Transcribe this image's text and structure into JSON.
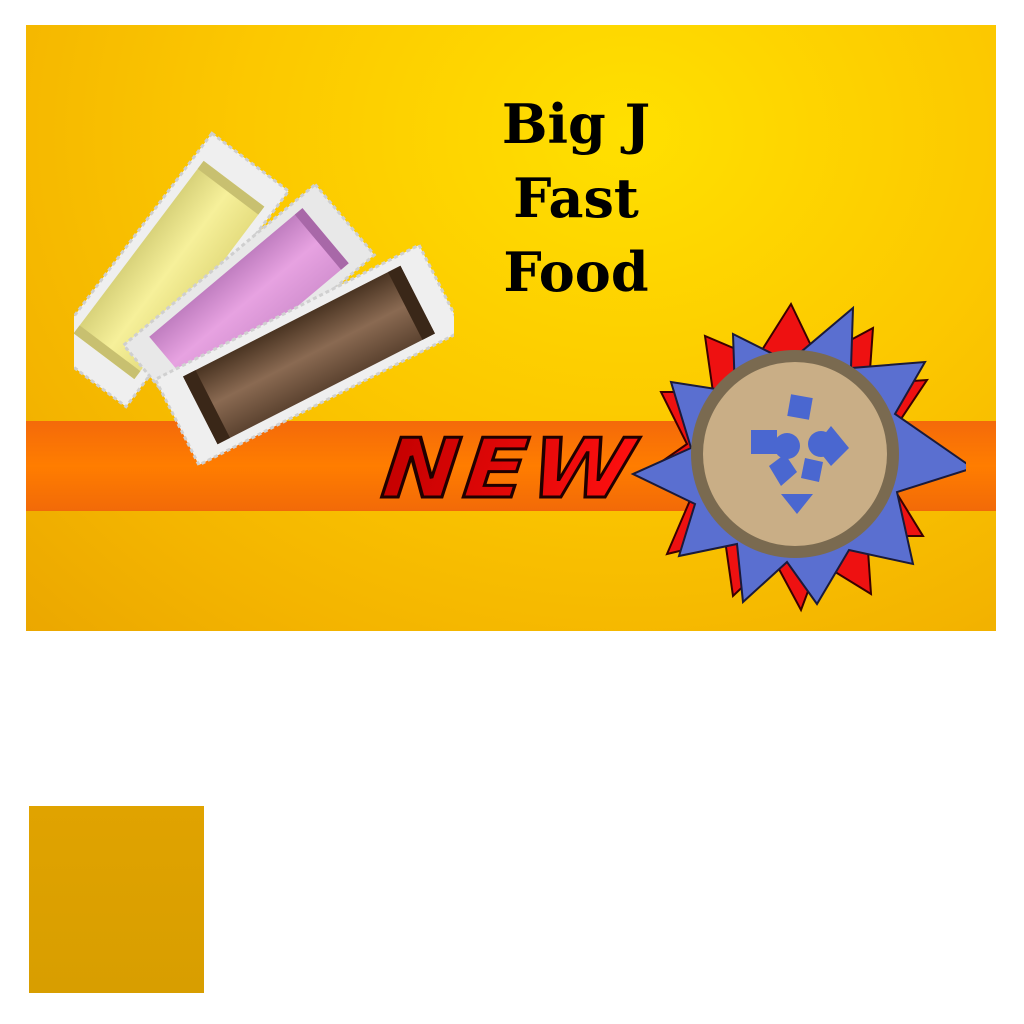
{
  "title": {
    "line1": "Big J",
    "line2": "Fast",
    "line3": "Food"
  },
  "stripe_text": "NEW",
  "badge": {
    "icon": "grapes-icon"
  },
  "colors": {
    "background": "#fcc800",
    "stripe": "#ff7d00",
    "new_text": "#e00000",
    "badge_red": "#ee1111",
    "badge_blue": "#5a6fd0",
    "badge_disc": "#c9ae86",
    "swatch": "#e0a300"
  }
}
